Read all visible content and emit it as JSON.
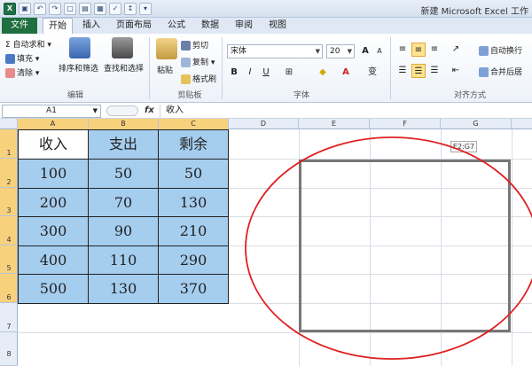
{
  "titlebar": {
    "title": "新建 Microsoft Excel 工作"
  },
  "qat": {
    "app_icon": "X",
    "undo": "↶",
    "redo": "↷",
    "more": "▾"
  },
  "tabs": [
    {
      "label": "文件"
    },
    {
      "label": "开始"
    },
    {
      "label": "插入"
    },
    {
      "label": "页面布局"
    },
    {
      "label": "公式"
    },
    {
      "label": "数据"
    },
    {
      "label": "审阅"
    },
    {
      "label": "视图"
    }
  ],
  "ribbon": {
    "edit": {
      "autosum": "Σ 自动求和 ▾",
      "fill": "填充 ▾",
      "clear": "清除 ▾",
      "sort": "排序和筛选",
      "find": "查找和选择",
      "group": "编辑"
    },
    "clipboard": {
      "paste": "粘贴",
      "cut": "剪切",
      "copy": "复制 ▾",
      "painter": "格式刷",
      "group": "剪贴板"
    },
    "font": {
      "name": "宋体",
      "size": "20",
      "bold": "B",
      "italic": "I",
      "underline": "U",
      "grow": "A",
      "shrink": "A",
      "group": "字体"
    },
    "align": {
      "wrap": "自动换行",
      "merge": "合并后居",
      "group": "对齐方式"
    }
  },
  "formula_bar": {
    "namebox": "A1",
    "fx": "fx",
    "content": "收入"
  },
  "columns": [
    "A",
    "B",
    "C",
    "D",
    "E",
    "F",
    "G"
  ],
  "rows": [
    "1",
    "2",
    "3",
    "4",
    "5",
    "6",
    "7",
    "8"
  ],
  "table": {
    "headers": [
      "收入",
      "支出",
      "剩余"
    ],
    "rows": [
      [
        "100",
        "50",
        "50"
      ],
      [
        "200",
        "70",
        "130"
      ],
      [
        "300",
        "90",
        "210"
      ],
      [
        "400",
        "110",
        "290"
      ],
      [
        "500",
        "130",
        "370"
      ]
    ]
  },
  "range_tooltip": "E2:G7",
  "colors": {
    "accent": "#1f6f3f",
    "cell_fill": "#a5cdee",
    "annotation": "#e02020",
    "selection": "#f8d17d"
  }
}
